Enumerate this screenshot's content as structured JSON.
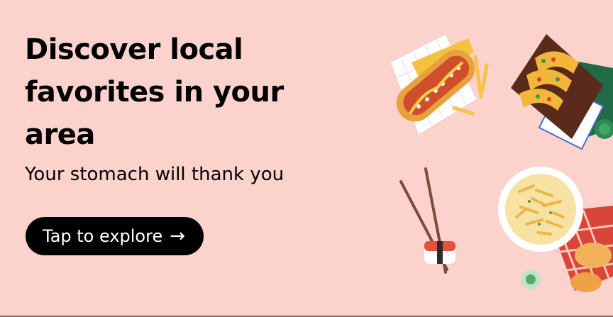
{
  "banner": {
    "headline": "Discover local favorites in your area",
    "subhead": "Your stomach will thank you",
    "cta_label": "Tap to explore",
    "cta_arrow": "→"
  },
  "colors": {
    "background": "#fbd2cc",
    "cta_background": "#000000",
    "cta_text": "#ffffff",
    "text": "#000000"
  },
  "illustrations": [
    "hot-dog-icon",
    "tacos-icon",
    "chopsticks-icon",
    "sushi-icon",
    "pasta-plate-icon",
    "bread-icon",
    "dip-bowl-icon"
  ]
}
